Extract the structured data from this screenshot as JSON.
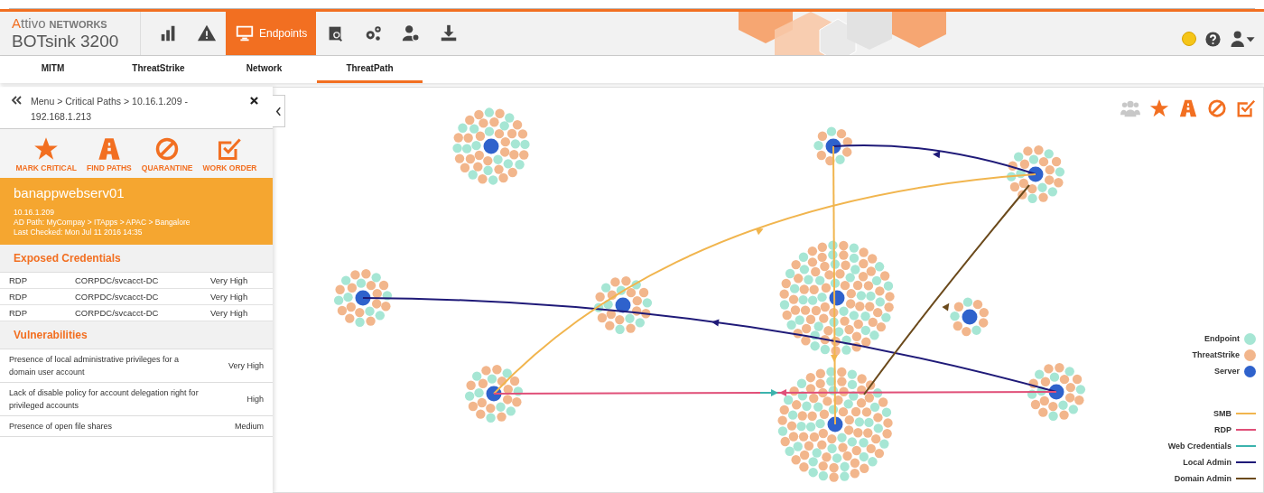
{
  "brand": {
    "name": "Attivo",
    "suffix": "NETWORKS",
    "product": "BOTsink 3200"
  },
  "nav": [
    {
      "kind": "chart",
      "selected": false
    },
    {
      "kind": "alert",
      "selected": false
    },
    {
      "kind": "monitor",
      "label": "Endpoints",
      "selected": true
    },
    {
      "kind": "scan",
      "selected": false
    },
    {
      "kind": "gears",
      "selected": false
    },
    {
      "kind": "user-gear",
      "selected": false
    },
    {
      "kind": "download",
      "selected": false
    }
  ],
  "status": {
    "color": "#f5c518"
  },
  "subtabs": [
    {
      "label": "MITM",
      "selected": false
    },
    {
      "label": "ThreatStrike",
      "selected": false
    },
    {
      "label": "Network",
      "selected": false
    },
    {
      "label": "ThreatPath",
      "selected": true
    }
  ],
  "panel": {
    "breadcrumb": "Menu > Critical Paths > 10.16.1.209 - 192.168.1.213",
    "actions": [
      {
        "kind": "star",
        "label": "MARK CRITICAL"
      },
      {
        "kind": "road",
        "label": "FIND PATHS"
      },
      {
        "kind": "ban",
        "label": "QUARANTINE"
      },
      {
        "kind": "check",
        "label": "WORK ORDER"
      }
    ],
    "host": {
      "name": "banappwebserv01",
      "ip": "10.16.1.209",
      "ad_path": "AD Path: MyCompay > ITApps > APAC > Bangalore",
      "last_checked": "Last Checked: Mon Jul 11 2016 14:35"
    },
    "credentials": {
      "title": "Exposed Credentials",
      "rows": [
        [
          "RDP",
          "CORPDC/svcacct-DC",
          "Very High"
        ],
        [
          "RDP",
          "CORPDC/svcacct-DC",
          "Very High"
        ],
        [
          "RDP",
          "CORPDC/svcacct-DC",
          "Very High"
        ]
      ]
    },
    "vulnerabilities": {
      "title": "Vulnerabilities",
      "rows": [
        [
          "Presence of local administrative privileges for a domain user account",
          "Very High"
        ],
        [
          "Lack of disable policy for account delegation right for privileged accounts",
          "High"
        ],
        [
          "Presence of open file shares",
          "Medium"
        ]
      ]
    }
  },
  "toolbar": [
    {
      "kind": "group",
      "disabled": true
    },
    {
      "kind": "star",
      "disabled": false
    },
    {
      "kind": "road",
      "disabled": false
    },
    {
      "kind": "ban",
      "disabled": false
    },
    {
      "kind": "check",
      "disabled": false
    }
  ],
  "legend": {
    "nodes": [
      {
        "label": "Endpoint",
        "color": "#a6e6d4"
      },
      {
        "label": "ThreatStrike",
        "color": "#f2b68c"
      },
      {
        "label": "Server",
        "color": "#2f62cc"
      }
    ],
    "links": [
      {
        "label": "SMB",
        "color": "#f1b54e"
      },
      {
        "label": "RDP",
        "color": "#e04f78"
      },
      {
        "label": "Web Credentials",
        "color": "#3bb3ad"
      },
      {
        "label": "Local Admin",
        "color": "#1f1a78"
      },
      {
        "label": "Domain Admin",
        "color": "#6b4a1c"
      }
    ]
  }
}
